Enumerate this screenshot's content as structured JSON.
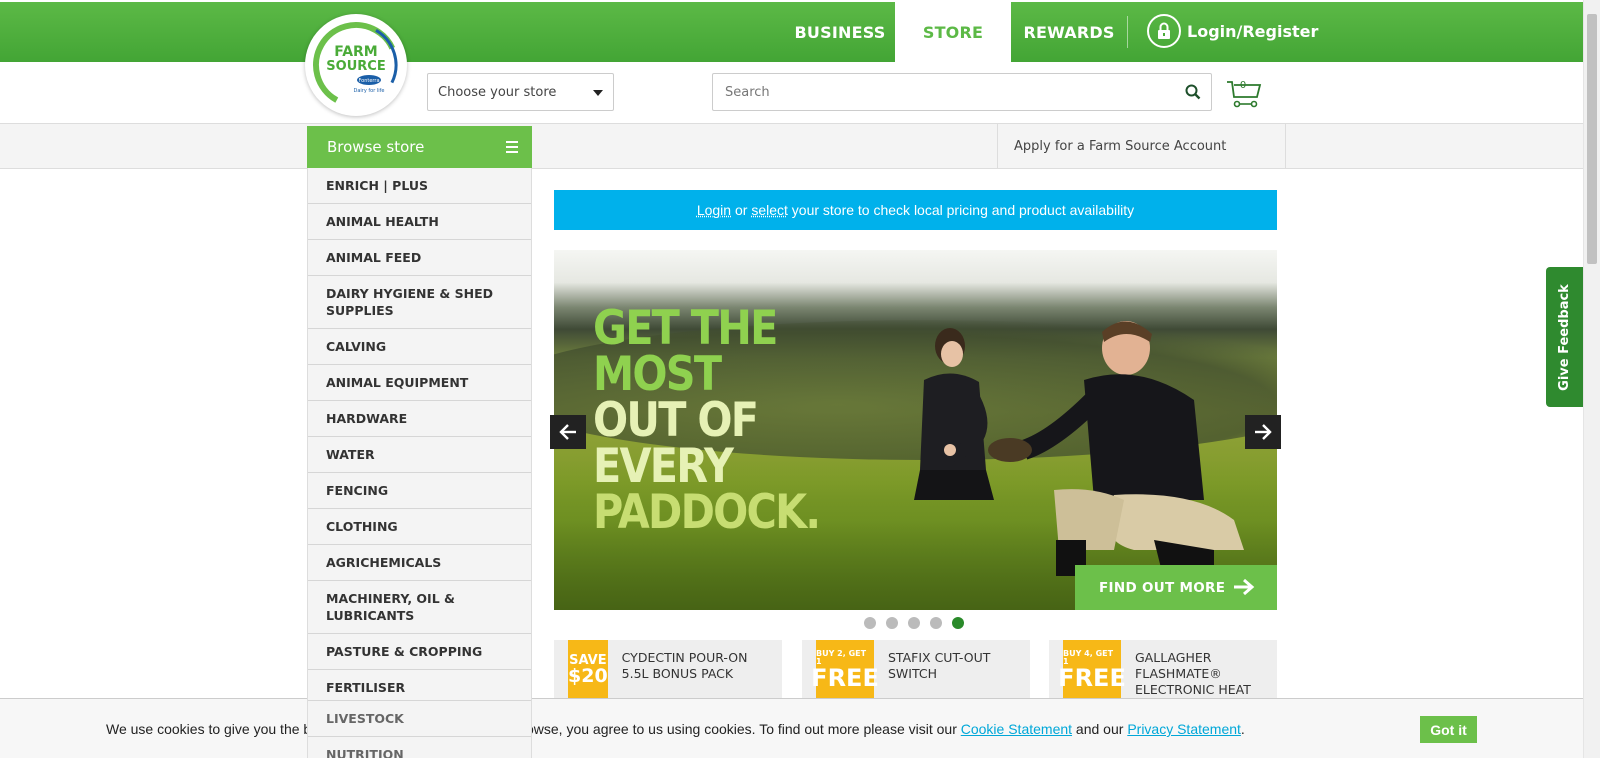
{
  "nav": {
    "business": "BUSINESS",
    "store": "STORE",
    "rewards": "REWARDS",
    "login": "Login/Register"
  },
  "logo": {
    "line1": "FARM",
    "line2": "SOURCE",
    "brand": "Fonterra",
    "tagline": "Dairy for life"
  },
  "header": {
    "store_select": "Choose your store",
    "search_placeholder": "Search",
    "cart_count": "0"
  },
  "band": {
    "apply_account": "Apply for a Farm Source Account"
  },
  "sidebar": {
    "title": "Browse store",
    "items": [
      "ENRICH | PLUS",
      "ANIMAL HEALTH",
      "ANIMAL FEED",
      "DAIRY HYGIENE & SHED SUPPLIES",
      "CALVING",
      "ANIMAL EQUIPMENT",
      "HARDWARE",
      "WATER",
      "FENCING",
      "CLOTHING",
      "AGRICHEMICALS",
      "MACHINERY, OIL & LUBRICANTS",
      "PASTURE & CROPPING",
      "FERTILISER",
      "LIVESTOCK",
      "NUTRITION"
    ]
  },
  "notice": {
    "login": "Login",
    "or": " or ",
    "select": "select",
    "rest": " your store to check local pricing and product availability"
  },
  "hero": {
    "line1": "GET THE MOST",
    "line2": "OUT OF EVERY",
    "line3": "PADDOCK.",
    "cta": "FIND OUT MORE",
    "slide_count": 5,
    "active_slide": 5
  },
  "promos": [
    {
      "badge_small": "SAVE",
      "badge_big": "$20",
      "text": "CYDECTIN POUR-ON 5.5L BONUS PACK"
    },
    {
      "badge_small": "BUY 2, GET 1",
      "badge_big": "FREE",
      "text": "STAFIX CUT-OUT SWITCH"
    },
    {
      "badge_small": "BUY 4, GET 1",
      "badge_big": "FREE",
      "text": "GALLAGHER FLASHMATE® ELECTRONIC HEAT"
    }
  ],
  "feedback": "Give Feedback",
  "cookie": {
    "text1": "We use cookies to give you the best experience. By continuing to browse, you agree to us using cookies. To find out more please visit our ",
    "cookie_link": "Cookie Statement",
    "and": " and our ",
    "privacy_link": "Privacy Statement",
    "end": ".",
    "button": "Got it"
  },
  "colors": {
    "brand_green": "#5cb946",
    "accent_green": "#6cc04a",
    "notice_blue": "#00b1eb",
    "promo_yellow": "#f7b817",
    "feedback_green": "#2f8a2f"
  }
}
